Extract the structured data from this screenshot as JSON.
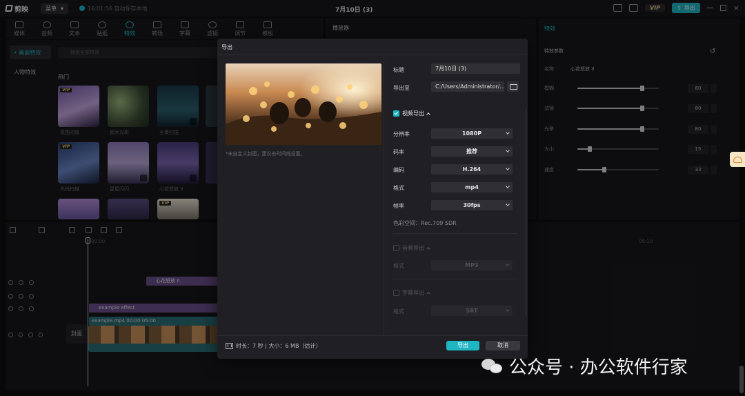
{
  "app": {
    "name": "剪映",
    "menu_label": "菜单",
    "autosave": "16:01:56 自动保存本地",
    "doc_title": "7月10日 (3)",
    "vip_label": "VIP",
    "export_label": "导出"
  },
  "toolbar": [
    {
      "label": "媒体",
      "active": false
    },
    {
      "label": "音频",
      "active": false
    },
    {
      "label": "文本",
      "active": false
    },
    {
      "label": "贴纸",
      "active": false
    },
    {
      "label": "特效",
      "active": true
    },
    {
      "label": "转场",
      "active": false
    },
    {
      "label": "字幕",
      "active": false
    },
    {
      "label": "滤镜",
      "active": false
    },
    {
      "label": "调节",
      "active": false
    },
    {
      "label": "模板",
      "active": false
    }
  ],
  "effects_panel": {
    "categories": [
      {
        "label": "• 画面特效",
        "active": true
      },
      {
        "label": "人物特效",
        "active": false
      }
    ],
    "search_placeholder": "搜索全部特效",
    "section_label": "热门",
    "items": [
      {
        "name": "氛围光辉",
        "vip": true,
        "download": false
      },
      {
        "name": "超大光斑",
        "vip": false,
        "download": false
      },
      {
        "name": "全景扫描",
        "vip": false,
        "download": true
      },
      {
        "name": "光线扫描",
        "vip": true,
        "download": false
      },
      {
        "name": "星星闪闪",
        "vip": false,
        "download": true
      },
      {
        "name": "心花怒放 II",
        "vip": false,
        "download": true
      }
    ]
  },
  "player": {
    "title": "播放器"
  },
  "effects_props": {
    "title": "特效",
    "section_label": "特效参数",
    "name_label": "名称",
    "name_value": "心花怒放 II",
    "params": [
      {
        "label": "模糊",
        "value": 80
      },
      {
        "label": "滤镜",
        "value": 80
      },
      {
        "label": "光晕",
        "value": 80
      },
      {
        "label": "大小",
        "value": 15
      },
      {
        "label": "速度",
        "value": 33
      }
    ]
  },
  "timeline": {
    "time_start": "00:00",
    "time_mark": "00:10",
    "effect_clip_label": "心花怒放 II",
    "example_effect_label": "example effect",
    "video_clip_label": "example.mp4  00:00:05:00",
    "cover_label": "封面"
  },
  "dialog": {
    "title": "导出",
    "preview_note": "*未自定义封面，建议去时间线设置。",
    "fields": {
      "title_label": "标题",
      "title_value": "7月10日 (3)",
      "export_to_label": "导出至",
      "export_to_value": "C:/Users/Administrator/..."
    },
    "video_section": {
      "label": "视频导出",
      "checked": true,
      "rows": [
        {
          "label": "分辨率",
          "value": "1080P"
        },
        {
          "label": "码率",
          "value": "推荐"
        },
        {
          "label": "编码",
          "value": "H.264"
        },
        {
          "label": "格式",
          "value": "mp4"
        },
        {
          "label": "帧率",
          "value": "30fps"
        }
      ],
      "color_space": "色彩空间：Rec.709 SDR"
    },
    "audio_section": {
      "label": "音频导出",
      "checked": false,
      "row_label": "格式",
      "row_value": "MP3"
    },
    "subtitle_section": {
      "label": "字幕导出",
      "checked": false,
      "row_label": "格式",
      "row_value": "SRT"
    },
    "footer_info": "时长：7 秒 | 大小：6 MB（估计）",
    "export_button": "导出",
    "cancel_button": "取消"
  },
  "watermark": {
    "text": "公众号 · 办公软件行家"
  },
  "colors": {
    "accent": "#1fb6c4",
    "vip": "#e6c98a",
    "panel": "#18181b",
    "dialog": "#202024"
  }
}
